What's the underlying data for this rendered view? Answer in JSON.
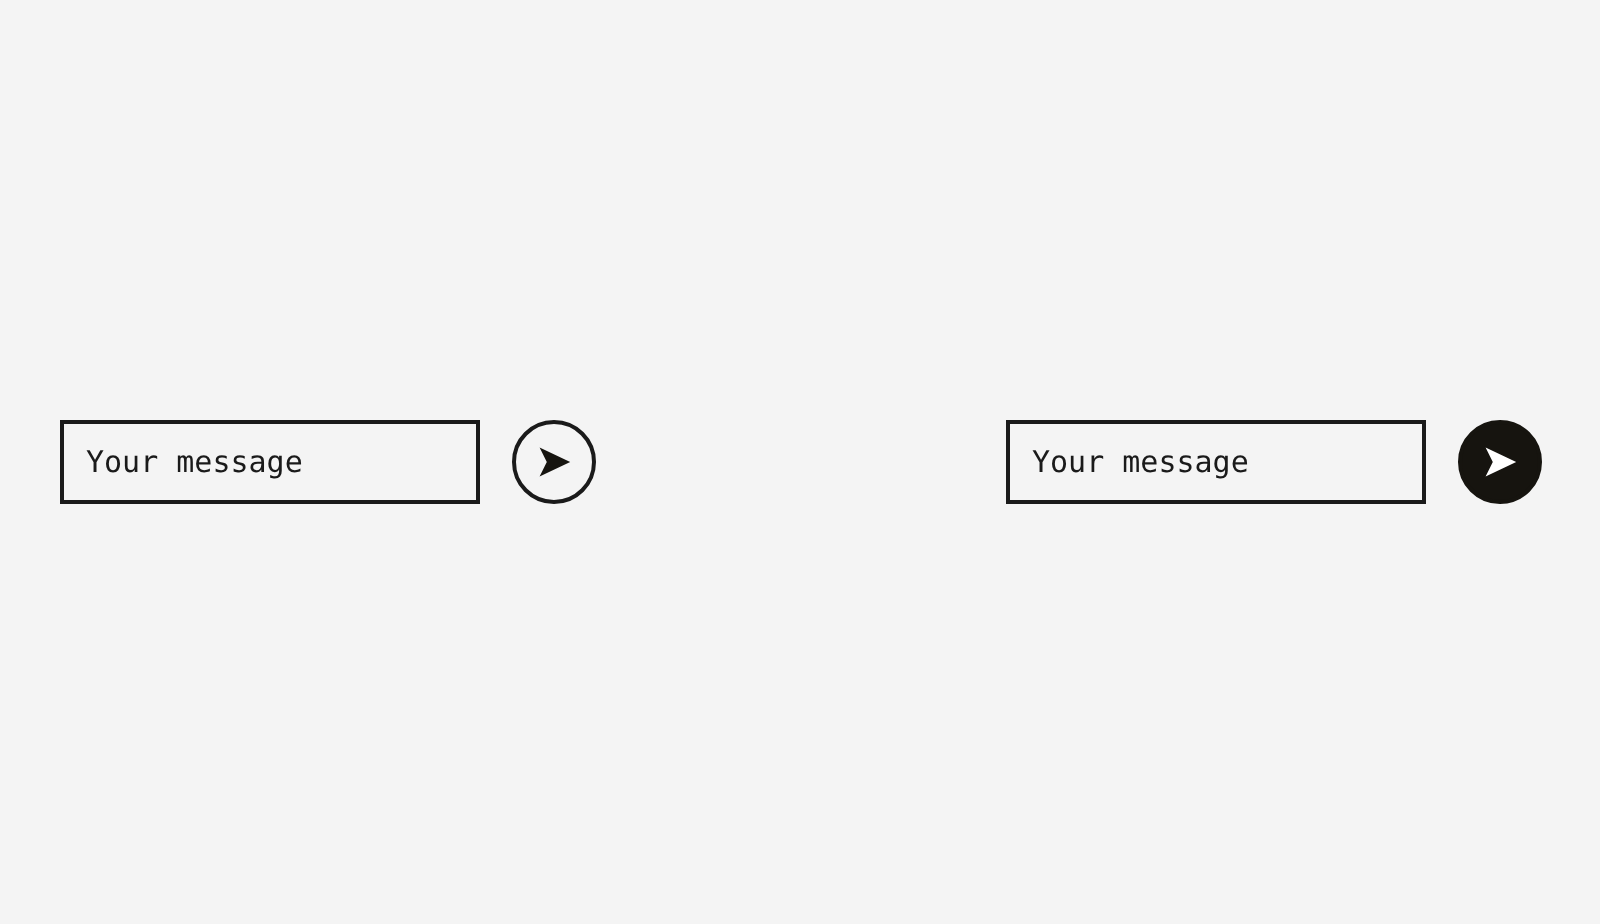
{
  "forms": [
    {
      "field": {
        "placeholder": "Your message"
      },
      "send_button": {
        "filled": false
      }
    },
    {
      "field": {
        "placeholder": "Your message"
      },
      "send_button": {
        "filled": true
      }
    }
  ]
}
